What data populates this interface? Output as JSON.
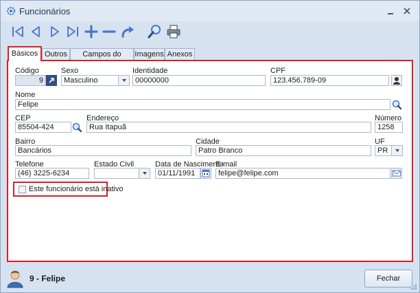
{
  "window": {
    "title": "Funcionários"
  },
  "toolbar": {
    "buttons": [
      "first-icon",
      "prev-icon",
      "next-icon",
      "last-icon",
      "add-icon",
      "remove-icon",
      "undo-icon",
      "search-icon",
      "print-icon"
    ]
  },
  "tabs": [
    {
      "label": "Básicos",
      "active": true
    },
    {
      "label": "Outros"
    },
    {
      "label": "Campos do Usuário"
    },
    {
      "label": "Imagens"
    },
    {
      "label": "Anexos"
    }
  ],
  "form": {
    "codigo": {
      "label": "Código",
      "value": "9"
    },
    "sexo": {
      "label": "Sexo",
      "value": "Masculino"
    },
    "identidade": {
      "label": "Identidade",
      "value": "00000000"
    },
    "cpf": {
      "label": "CPF",
      "value": "123.456.789-09"
    },
    "nome": {
      "label": "Nome",
      "value": "Felipe"
    },
    "cep": {
      "label": "CEP",
      "value": "85504-424"
    },
    "endereco": {
      "label": "Endereço",
      "value": "Rua Itapuã"
    },
    "numero": {
      "label": "Número",
      "value": "1258"
    },
    "bairro": {
      "label": "Bairro",
      "value": "Bancários"
    },
    "cidade": {
      "label": "Cidade",
      "value": "Patro Branco"
    },
    "uf": {
      "label": "UF",
      "value": "PR"
    },
    "telefone": {
      "label": "Telefone",
      "value": "(46) 3225-6234"
    },
    "estado_civil": {
      "label": "Estado Civil",
      "value": ""
    },
    "nascimento": {
      "label": "Data de Nascimento",
      "value": "01/11/1991"
    },
    "email": {
      "label": "E-mail",
      "value": "felipe@felipe.com"
    },
    "inativo": {
      "label": "Este funcionário está inativo",
      "checked": false
    }
  },
  "status": {
    "record": "9 - Felipe"
  },
  "actions": {
    "close_label": "Fechar"
  },
  "colors": {
    "highlight": "#d6202a",
    "toolbar_icon": "#4a78c8",
    "field_border": "#a9b8cc"
  }
}
